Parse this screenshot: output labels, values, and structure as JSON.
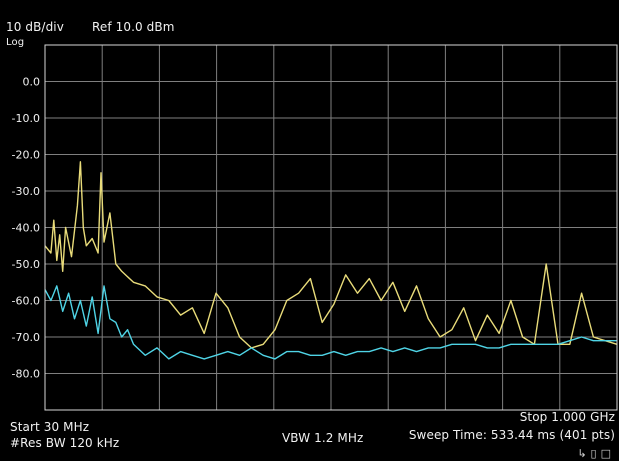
{
  "header": {
    "scale": "10 dB/div",
    "log": "Log",
    "ref": "Ref 10.0 dBm"
  },
  "footer": {
    "start": "Start 30 MHz",
    "res_bw": "#Res BW 120 kHz",
    "vbw": "VBW 1.2 MHz",
    "stop": "Stop 1.000 GHz",
    "sweep": "Sweep Time: 533.44 ms (401 pts)"
  },
  "status_icons": [
    "cursor-icon",
    "lock-icon",
    "disk-icon"
  ],
  "chart_data": {
    "type": "line",
    "xlabel": "",
    "ylabel": "",
    "xlim": [
      30,
      1000
    ],
    "ylim": [
      -90,
      10
    ],
    "yticks": [
      "0.0",
      "-10.0",
      "-20.0",
      "-30.0",
      "-40.0",
      "-50.0",
      "-60.0",
      "-70.0",
      "-80.0"
    ],
    "grid": true,
    "colors": {
      "trace1": "#e9dc7a",
      "trace2": "#4fd4e6",
      "grid": "#7f7f7f",
      "frame": "#d8d8d8"
    },
    "series": [
      {
        "color": "#e9dc7a",
        "x": [
          30,
          40,
          45,
          50,
          55,
          60,
          65,
          75,
          85,
          90,
          95,
          100,
          110,
          120,
          125,
          130,
          140,
          150,
          160,
          180,
          200,
          220,
          240,
          260,
          280,
          300,
          320,
          340,
          360,
          380,
          400,
          420,
          440,
          460,
          480,
          500,
          520,
          540,
          560,
          580,
          600,
          620,
          640,
          660,
          680,
          700,
          720,
          740,
          760,
          780,
          800,
          820,
          840,
          860,
          880,
          900,
          920,
          940,
          960,
          980,
          1000
        ],
        "y": [
          -45,
          -47,
          -38,
          -49,
          -42,
          -52,
          -40,
          -48,
          -34,
          -22,
          -40,
          -45,
          -43,
          -47,
          -25,
          -44,
          -36,
          -50,
          -52,
          -55,
          -56,
          -59,
          -60,
          -64,
          -62,
          -69,
          -58,
          -62,
          -70,
          -73,
          -72,
          -68,
          -60,
          -58,
          -54,
          -66,
          -61,
          -53,
          -58,
          -54,
          -60,
          -55,
          -63,
          -56,
          -65,
          -70,
          -68,
          -62,
          -71,
          -64,
          -69,
          -60,
          -70,
          -72,
          -50,
          -72,
          -72,
          -58,
          -70,
          -71,
          -72
        ]
      },
      {
        "color": "#4fd4e6",
        "x": [
          30,
          40,
          50,
          60,
          70,
          80,
          90,
          100,
          110,
          120,
          130,
          140,
          150,
          160,
          170,
          180,
          200,
          220,
          240,
          260,
          280,
          300,
          320,
          340,
          360,
          380,
          400,
          420,
          440,
          460,
          480,
          500,
          520,
          540,
          560,
          580,
          600,
          620,
          640,
          660,
          680,
          700,
          720,
          740,
          760,
          780,
          800,
          820,
          840,
          860,
          880,
          900,
          920,
          940,
          960,
          980,
          1000
        ],
        "y": [
          -57,
          -60,
          -56,
          -63,
          -58,
          -65,
          -60,
          -67,
          -59,
          -69,
          -56,
          -65,
          -66,
          -70,
          -68,
          -72,
          -75,
          -73,
          -76,
          -74,
          -75,
          -76,
          -75,
          -74,
          -75,
          -73,
          -75,
          -76,
          -74,
          -74,
          -75,
          -75,
          -74,
          -75,
          -74,
          -74,
          -73,
          -74,
          -73,
          -74,
          -73,
          -73,
          -72,
          -72,
          -72,
          -73,
          -73,
          -72,
          -72,
          -72,
          -72,
          -72,
          -71,
          -70,
          -71,
          -71,
          -71
        ]
      }
    ]
  }
}
